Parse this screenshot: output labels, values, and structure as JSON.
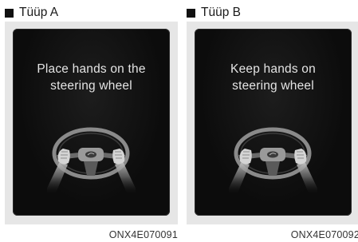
{
  "panels": [
    {
      "title": "Tüüp A",
      "message_line1": "Place hands on the",
      "message_line2": "steering wheel",
      "caption": "ONX4E070091"
    },
    {
      "title": "Tüüp B",
      "message_line1": "Keep hands on",
      "message_line2": "steering wheel",
      "caption": "ONX4E070092"
    }
  ],
  "icons": {
    "steering": "steering-wheel-with-hands-icon"
  },
  "colors": {
    "screen": "#0c0c0c",
    "screen_text": "#e4e4e4",
    "figure_background": "#e6e6e6"
  }
}
